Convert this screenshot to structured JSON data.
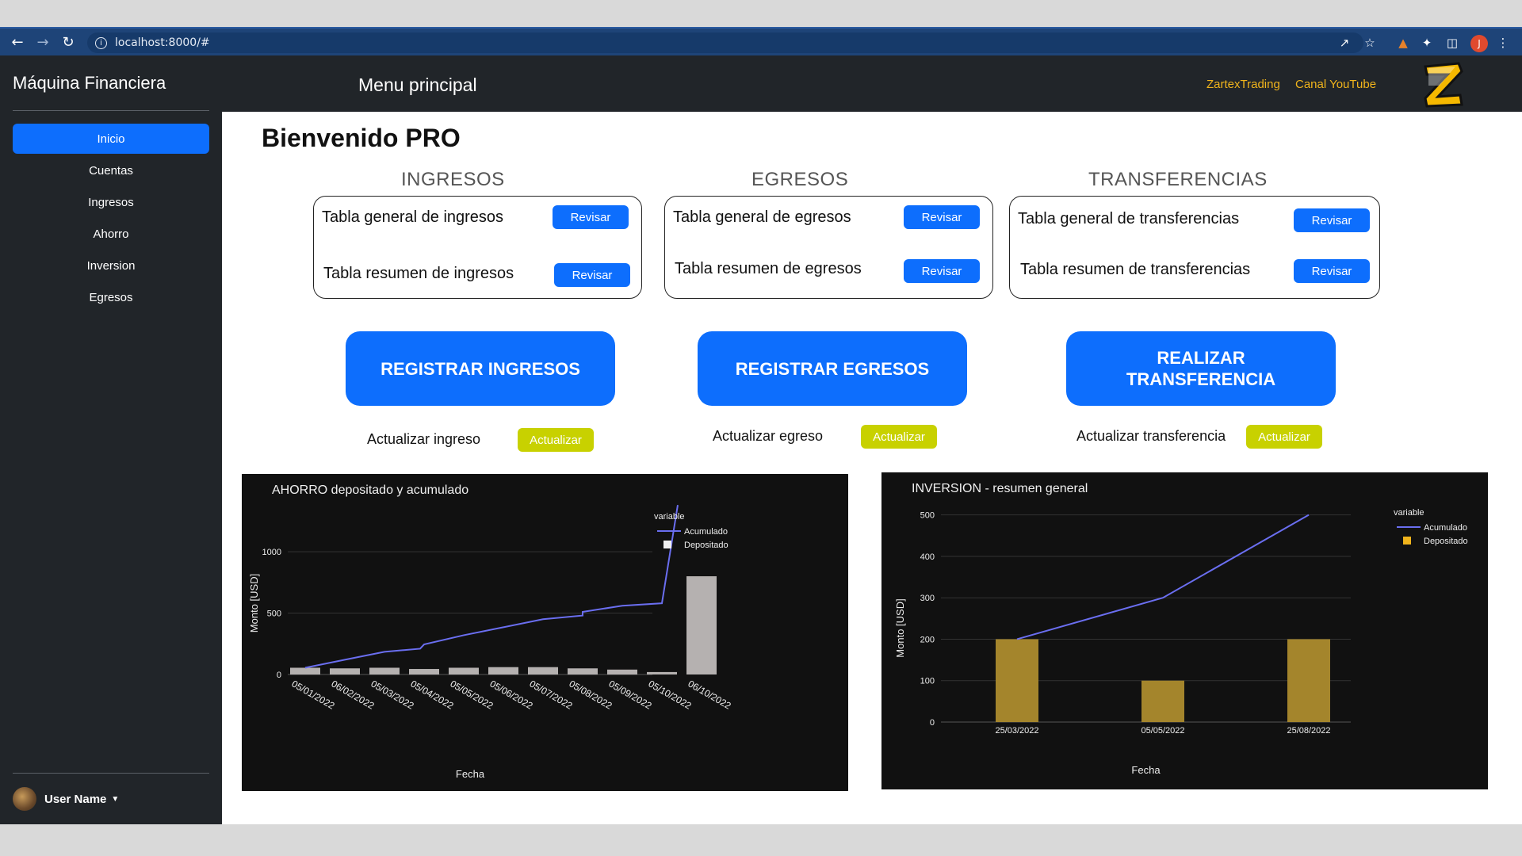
{
  "browser": {
    "url": "localhost:8000/#",
    "profile_initial": "J"
  },
  "header": {
    "brand": "Máquina Financiera",
    "menu_title": "Menu principal",
    "links": [
      "ZartexTrading",
      "Canal YouTube"
    ]
  },
  "sidebar": {
    "items": [
      {
        "label": "Inicio",
        "active": true
      },
      {
        "label": "Cuentas"
      },
      {
        "label": "Ingresos"
      },
      {
        "label": "Ahorro"
      },
      {
        "label": "Inversion"
      },
      {
        "label": "Egresos"
      }
    ],
    "user_name": "User Name"
  },
  "main": {
    "welcome": "Bienvenido PRO",
    "sections": [
      {
        "title": "INGRESOS",
        "row1": "Tabla general de ingresos",
        "row2": "Tabla resumen de ingresos",
        "btn": "Revisar",
        "big_button": "REGISTRAR INGRESOS",
        "update_label": "Actualizar ingreso",
        "update_btn": "Actualizar"
      },
      {
        "title": "EGRESOS",
        "row1": "Tabla general de egresos",
        "row2": "Tabla resumen de egresos",
        "btn": "Revisar",
        "big_button": "REGISTRAR EGRESOS",
        "update_label": "Actualizar egreso",
        "update_btn": "Actualizar"
      },
      {
        "title": "TRANSFERENCIAS",
        "row1": "Tabla general de transferencias",
        "row2": "Tabla resumen de transferencias",
        "btn": "Revisar",
        "big_button": "REALIZAR TRANSFERENCIA",
        "update_label": "Actualizar transferencia",
        "update_btn": "Actualizar"
      }
    ]
  },
  "colors": {
    "primary": "#0d6efd",
    "warning_btn": "#c8d100",
    "link": "#f0b41c",
    "line": "#6a6ef0",
    "ahorro_bar": "#b5b1b0",
    "inversion_bar": "#a4852c"
  },
  "chart_data": [
    {
      "type": "bar",
      "title": "AHORRO depositado y acumulado",
      "xlabel": "Fecha",
      "ylabel": "Monto [USD]",
      "legend_title": "variable",
      "legend_position": "top-right",
      "ylim": [
        0,
        1420
      ],
      "yticks": [
        0,
        500,
        1000
      ],
      "categories": [
        "05/01/2022",
        "06/02/2022",
        "05/03/2022",
        "05/04/2022",
        "05/05/2022",
        "05/06/2022",
        "05/07/2022",
        "05/08/2022",
        "05/09/2022",
        "05/10/2022",
        "06/10/2022"
      ],
      "series": [
        {
          "name": "Acumulado",
          "kind": "line",
          "x": [
            0,
            1,
            2,
            2.9,
            3,
            4,
            5,
            6,
            7,
            7.0,
            8,
            9,
            9.4
          ],
          "values": [
            55,
            120,
            185,
            210,
            245,
            320,
            385,
            450,
            480,
            510,
            560,
            580,
            1380
          ]
        },
        {
          "name": "Depositado",
          "kind": "bar",
          "values": [
            55,
            50,
            55,
            45,
            55,
            60,
            60,
            50,
            40,
            20,
            800
          ]
        }
      ]
    },
    {
      "type": "bar",
      "title": "INVERSION - resumen general",
      "xlabel": "Fecha",
      "ylabel": "Monto [USD]",
      "legend_title": "variable",
      "legend_position": "top-right",
      "ylim": [
        0,
        530
      ],
      "yticks": [
        0,
        100,
        200,
        300,
        400,
        500
      ],
      "categories": [
        "25/03/2022",
        "05/05/2022",
        "25/08/2022"
      ],
      "series": [
        {
          "name": "Acumulado",
          "kind": "line",
          "values": [
            200,
            300,
            500
          ]
        },
        {
          "name": "Depositado",
          "kind": "bar",
          "values": [
            200,
            100,
            200
          ]
        }
      ]
    }
  ]
}
